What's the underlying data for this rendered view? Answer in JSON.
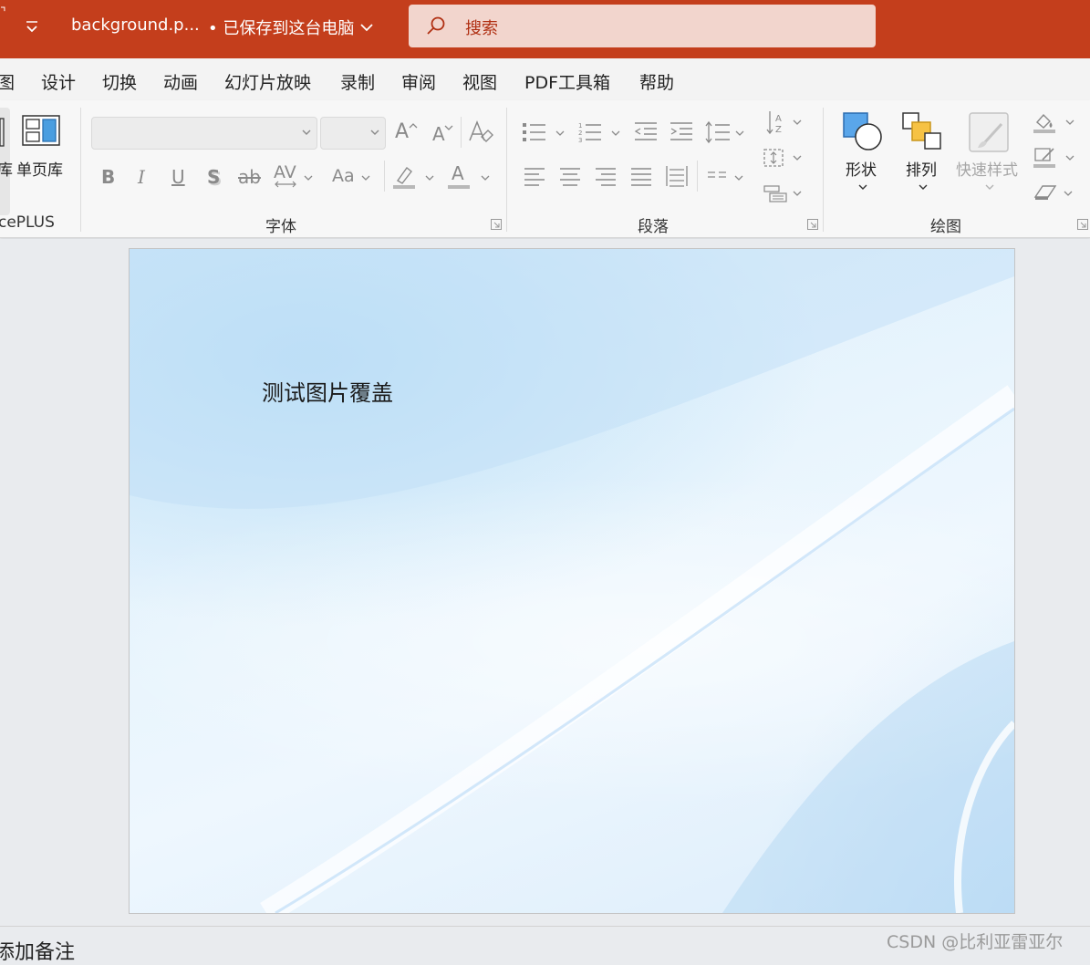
{
  "titlebar": {
    "edge_glyph": "⌝",
    "file_name": "background.p...",
    "save_status": "• 已保存到这台电脑",
    "bg_color": "#c43e1c",
    "qat_icon": "customize-qat-icon"
  },
  "search": {
    "placeholder": "搜索",
    "icon": "search-icon"
  },
  "tabs": [
    {
      "label": "图"
    },
    {
      "label": "设计"
    },
    {
      "label": "切换"
    },
    {
      "label": "动画"
    },
    {
      "label": "幻灯片放映"
    },
    {
      "label": "录制"
    },
    {
      "label": "审阅"
    },
    {
      "label": "视图"
    },
    {
      "label": "PDF工具箱"
    },
    {
      "label": "帮助"
    }
  ],
  "ribbon": {
    "officeplus": {
      "partial_label": "库",
      "single_page_label": "单页库",
      "group_label": "cePLUS"
    },
    "font": {
      "group_label": "字体",
      "font_name": "",
      "font_size": "",
      "bold": "B",
      "italic": "I",
      "underline": "U",
      "shadow": "S",
      "strike": "ab",
      "spacing": "AV",
      "case": "Aa",
      "grow": "A",
      "shrink": "A",
      "color_letter": "A"
    },
    "paragraph": {
      "group_label": "段落"
    },
    "drawing": {
      "group_label": "绘图",
      "shapes_label": "形状",
      "arrange_label": "排列",
      "quick_styles_label": "快速样式"
    }
  },
  "slide": {
    "text": "测试图片覆盖"
  },
  "status": {
    "notes_label": "添加备注"
  },
  "watermark": "CSDN @比利亚雷亚尔"
}
